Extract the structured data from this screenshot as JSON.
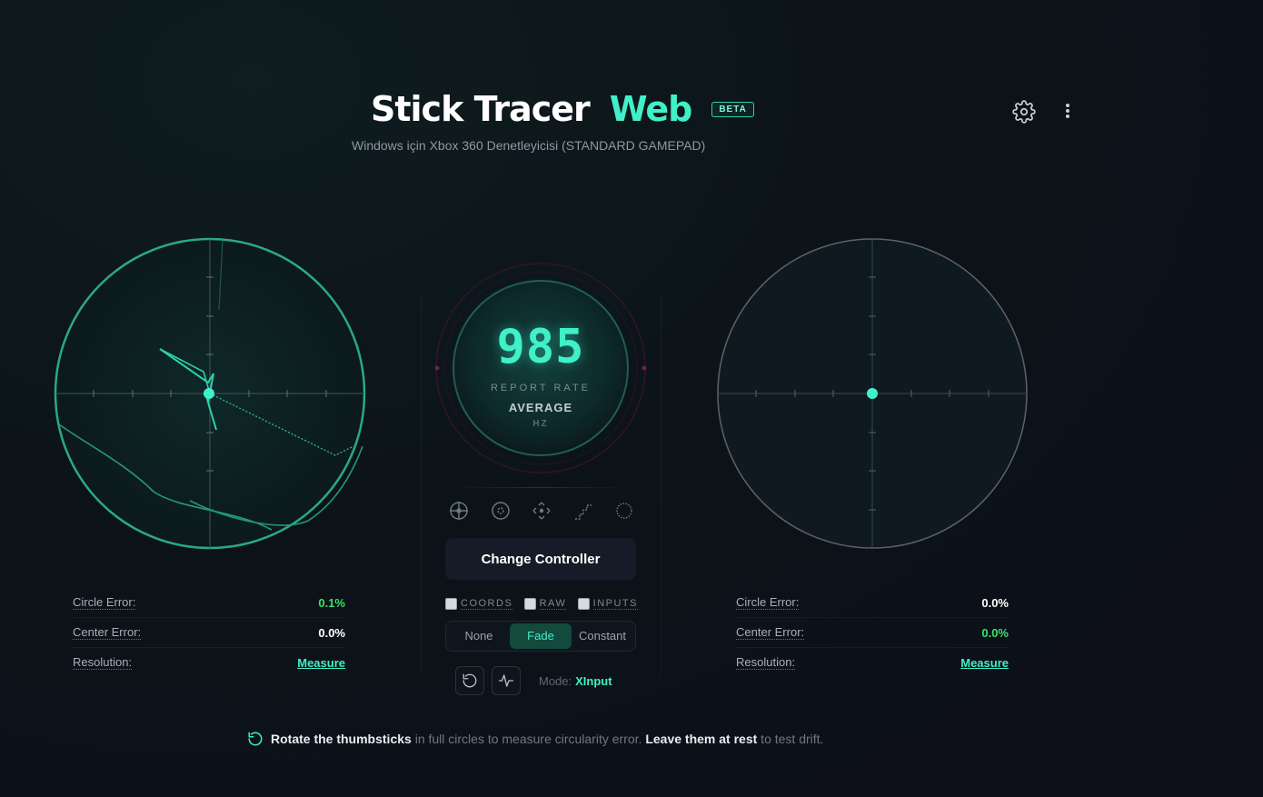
{
  "header": {
    "title_main": "Stick Tracer",
    "title_accent": "Web",
    "badge": "BETA",
    "subtitle": "Windows için Xbox 360 Denetleyicisi (STANDARD GAMEPAD)",
    "settings_icon": "gear-icon",
    "menu_icon": "kebab-menu-icon"
  },
  "left_stick": {
    "stats": [
      {
        "label": "Circle Error:",
        "value": "0.1%"
      },
      {
        "label": "Center Error:",
        "value": "0.0%"
      },
      {
        "label": "Resolution:",
        "value": "Measure"
      }
    ]
  },
  "right_stick": {
    "stats": [
      {
        "label": "Circle Error:",
        "value": "0.0%"
      },
      {
        "label": "Center Error:",
        "value": "0.0%"
      },
      {
        "label": "Resolution:",
        "value": "Measure"
      }
    ]
  },
  "report_rate": {
    "value": "985",
    "label": "REPORT RATE",
    "average": "AVERAGE",
    "unit": "HZ"
  },
  "view_modes": [
    "crosshair-icon",
    "circle-target-icon",
    "move-arrows-icon",
    "stairs-icon",
    "dotted-circle-icon"
  ],
  "change_controller": "Change Controller",
  "toggles": [
    {
      "label": "COORDS",
      "checked": false
    },
    {
      "label": "RAW",
      "checked": false
    },
    {
      "label": "INPUTS",
      "checked": false
    }
  ],
  "trail_modes": {
    "options": [
      "None",
      "Fade",
      "Constant"
    ],
    "selected": "Fade"
  },
  "tools": [
    "reset-icon",
    "pulse-icon"
  ],
  "mode": {
    "label": "Mode:",
    "value": "XInput"
  },
  "hint": {
    "strong1": "Rotate the thumbsticks",
    "text1": " in full circles to measure circularity error. ",
    "strong2": "Leave them at rest",
    "text2": " to test drift."
  },
  "colors": {
    "accent": "#3ff0c8",
    "good": "#39e06a",
    "background": "#0c1318"
  }
}
